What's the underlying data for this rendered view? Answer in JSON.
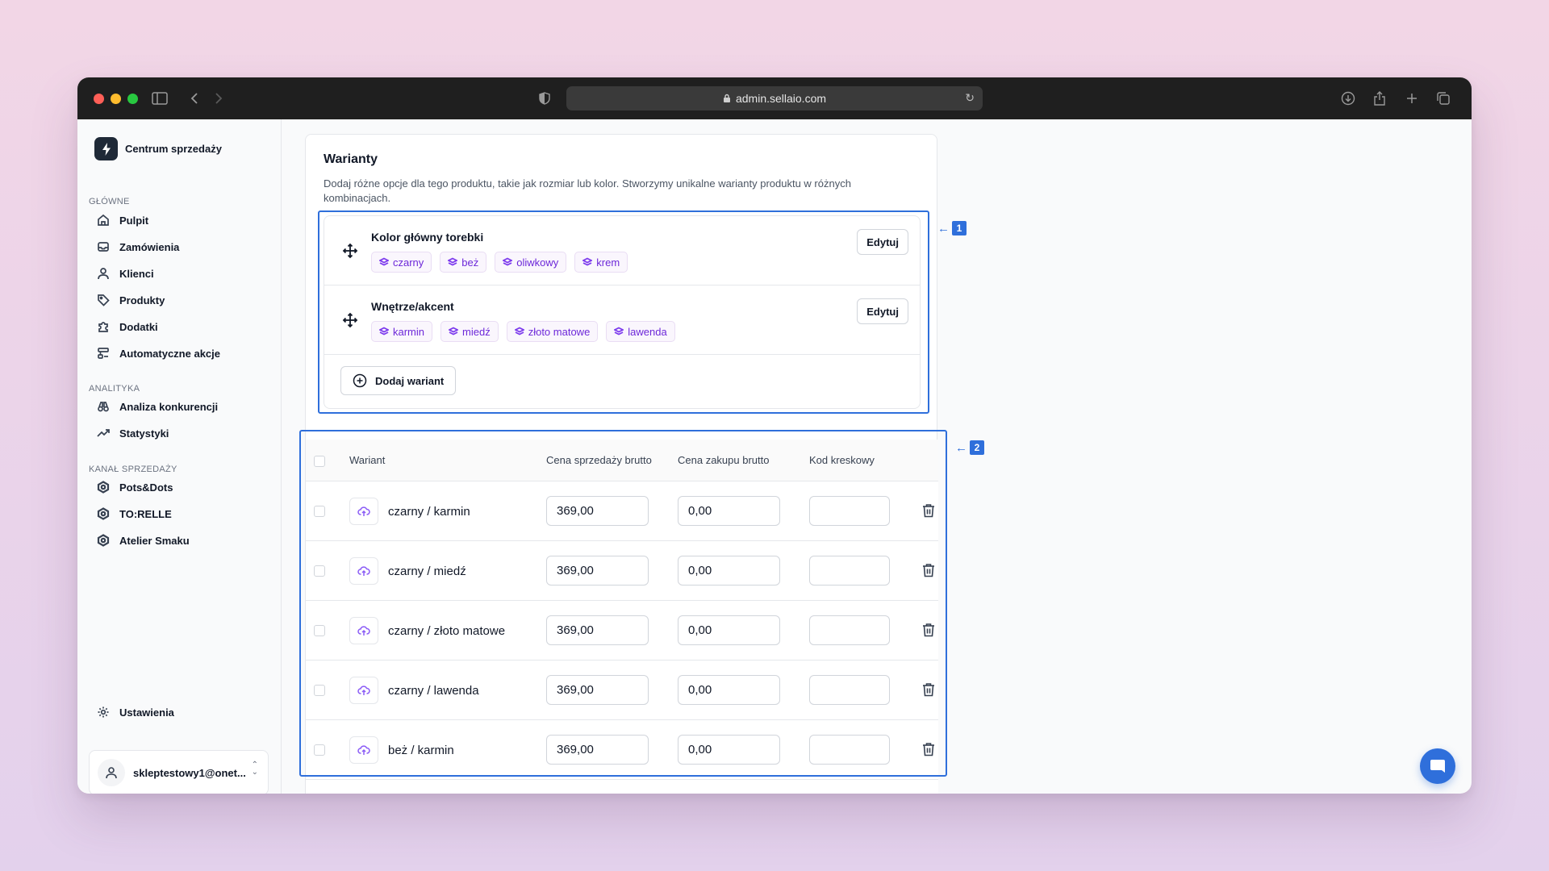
{
  "browser": {
    "url": "admin.sellaio.com",
    "traffic_colors": [
      "#ff5f57",
      "#febc2e",
      "#28c840"
    ]
  },
  "sidebar": {
    "brand": "Centrum sprzedaży",
    "sections": [
      {
        "label": "GŁÓWNE",
        "items": [
          {
            "label": "Pulpit",
            "icon": "home-icon"
          },
          {
            "label": "Zamówienia",
            "icon": "inbox-icon"
          },
          {
            "label": "Klienci",
            "icon": "user-icon"
          },
          {
            "label": "Produkty",
            "icon": "tag-icon"
          },
          {
            "label": "Dodatki",
            "icon": "puzzle-icon"
          },
          {
            "label": "Automatyczne akcje",
            "icon": "workflow-icon"
          }
        ]
      },
      {
        "label": "ANALITYKA",
        "items": [
          {
            "label": "Analiza konkurencji",
            "icon": "binoculars-icon"
          },
          {
            "label": "Statystyki",
            "icon": "trend-up-icon"
          }
        ]
      },
      {
        "label": "KANAŁ SPRZEDAŻY",
        "items": [
          {
            "label": "Pots&Dots",
            "icon": "channel-icon"
          },
          {
            "label": "TO:RELLE",
            "icon": "channel-icon"
          },
          {
            "label": "Atelier Smaku",
            "icon": "channel-icon"
          }
        ]
      }
    ],
    "settings": "Ustawienia",
    "user_email": "skleptestowy1@onet..."
  },
  "variants": {
    "title": "Warianty",
    "description": "Dodaj różne opcje dla tego produktu, takie jak rozmiar lub kolor. Stworzymy unikalne warianty produktu w różnych kombinacjach.",
    "options": [
      {
        "name": "Kolor główny torebki",
        "values": [
          "czarny",
          "beż",
          "oliwkowy",
          "krem"
        ],
        "edit": "Edytuj"
      },
      {
        "name": "Wnętrze/akcent",
        "values": [
          "karmin",
          "miedź",
          "złoto matowe",
          "lawenda"
        ],
        "edit": "Edytuj"
      }
    ],
    "add_variant": "Dodaj wariant"
  },
  "table": {
    "headers": {
      "variant": "Wariant",
      "sale_price": "Cena sprzedaży brutto",
      "purchase_price": "Cena zakupu brutto",
      "barcode": "Kod kreskowy"
    },
    "rows": [
      {
        "name": "czarny / karmin",
        "sale_price": "369,00",
        "purchase_price": "0,00",
        "barcode": ""
      },
      {
        "name": "czarny / miedź",
        "sale_price": "369,00",
        "purchase_price": "0,00",
        "barcode": ""
      },
      {
        "name": "czarny / złoto matowe",
        "sale_price": "369,00",
        "purchase_price": "0,00",
        "barcode": ""
      },
      {
        "name": "czarny / lawenda",
        "sale_price": "369,00",
        "purchase_price": "0,00",
        "barcode": ""
      },
      {
        "name": "beż / karmin",
        "sale_price": "369,00",
        "purchase_price": "0,00",
        "barcode": ""
      },
      {
        "name": "",
        "sale_price": "",
        "purchase_price": "",
        "barcode": ""
      }
    ]
  },
  "annotations": [
    {
      "label": "1",
      "arrow": "←"
    },
    {
      "label": "2",
      "arrow": "←"
    }
  ],
  "colors": {
    "accent": "#2f6fdb",
    "chip_text": "#6d28d9"
  }
}
